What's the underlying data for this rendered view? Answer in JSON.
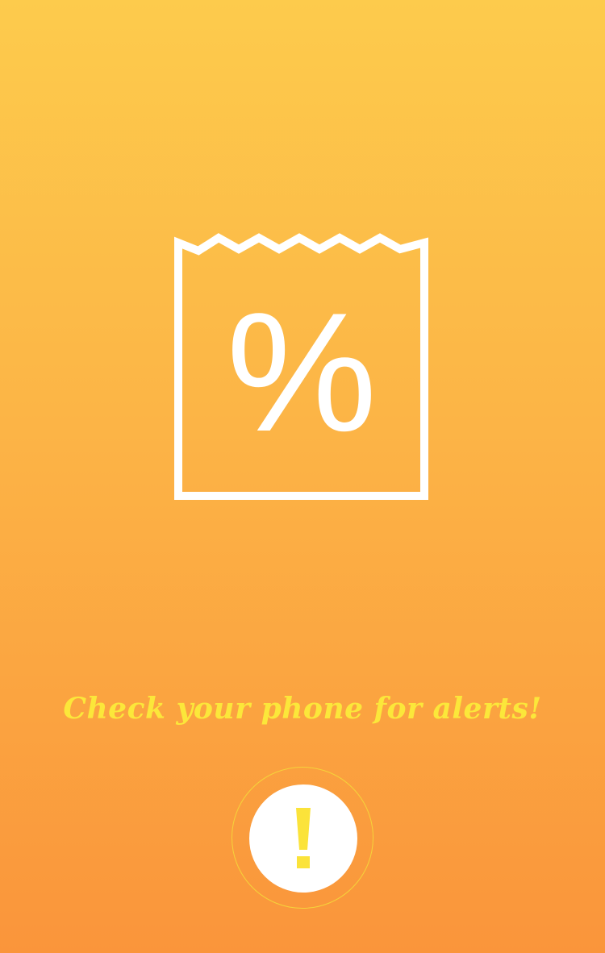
{
  "coupon": {
    "icon": "percent-coupon-icon",
    "symbol": "%"
  },
  "alert": {
    "message": "Check your phone for alerts!",
    "button_icon": "exclamation-icon",
    "button_symbol": "!"
  },
  "colors": {
    "gradient_top": "#FDCB4C",
    "gradient_bottom": "#FA953B",
    "accent_yellow": "#FBE73A",
    "icon_white": "#FFFFFF"
  }
}
